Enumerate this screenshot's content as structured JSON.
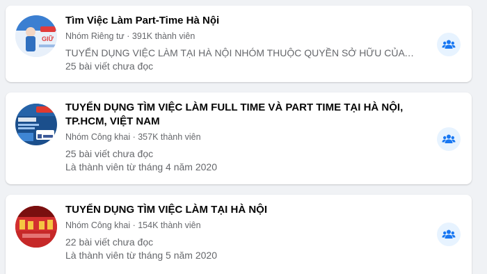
{
  "accent_color": "#1877f2",
  "groups": [
    {
      "name": "Tìm Việc Làm Part-Time Hà Nội",
      "privacy": "Nhóm Riêng tư",
      "members": "391K thành viên",
      "description": "TUYỂN DỤNG VIỆC LÀM TẠI HÀ NỘI NHÓM THUỘC QUYỀN SỞ HỮU CỦA TO...",
      "unread": "25 bài viết chưa đọc",
      "action_icon": "group-icon"
    },
    {
      "name": "TUYỂN DỤNG TÌM VIỆC LÀM FULL TIME VÀ PART TIME TẠI HÀ NỘI, TP.HCM, VIỆT NAM",
      "privacy": "Nhóm Công khai",
      "members": "357K thành viên",
      "unread": "25 bài viết chưa đọc",
      "member_since": "Là thành viên từ tháng 4 năm 2020",
      "action_icon": "group-icon"
    },
    {
      "name": "TUYỂN DỤNG TÌM VIỆC LÀM TẠI HÀ NỘI",
      "privacy": "Nhóm Công khai",
      "members": "154K thành viên",
      "unread": "22 bài viết chưa đọc",
      "member_since": "Là thành viên từ tháng 5 năm 2020",
      "action_icon": "group-icon"
    }
  ]
}
